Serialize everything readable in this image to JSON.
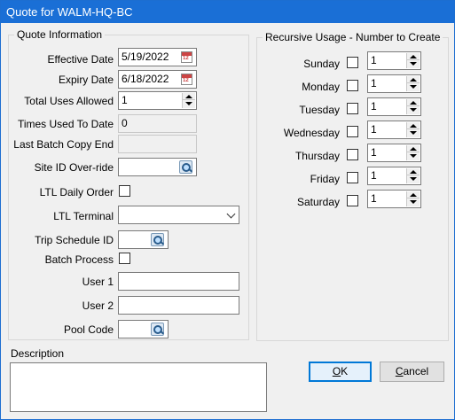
{
  "window": {
    "title": "Quote for WALM-HQ-BC"
  },
  "quote_info": {
    "group_title": "Quote Information",
    "effective_date": {
      "label": "Effective Date",
      "value": "5/19/2022"
    },
    "expiry_date": {
      "label": "Expiry Date",
      "value": "6/18/2022"
    },
    "total_uses_allowed": {
      "label": "Total Uses Allowed",
      "value": "1"
    },
    "times_used_to_date": {
      "label": "Times Used To Date",
      "value": "0"
    },
    "last_batch_copy_end": {
      "label": "Last Batch Copy End",
      "value": ""
    },
    "site_id_override": {
      "label": "Site ID Over-ride",
      "value": ""
    },
    "ltl_daily_order": {
      "label": "LTL Daily Order",
      "checked": false
    },
    "ltl_terminal": {
      "label": "LTL Terminal",
      "value": ""
    },
    "trip_schedule_id": {
      "label": "Trip Schedule ID",
      "value": ""
    },
    "batch_process": {
      "label": "Batch Process",
      "checked": false
    },
    "user1": {
      "label": "User 1",
      "value": ""
    },
    "user2": {
      "label": "User 2",
      "value": ""
    },
    "pool_code": {
      "label": "Pool Code",
      "value": ""
    }
  },
  "recursive_usage": {
    "group_title": "Recursive Usage - Number to Create",
    "days": [
      {
        "label": "Sunday",
        "checked": false,
        "value": "1"
      },
      {
        "label": "Monday",
        "checked": false,
        "value": "1"
      },
      {
        "label": "Tuesday",
        "checked": false,
        "value": "1"
      },
      {
        "label": "Wednesday",
        "checked": false,
        "value": "1"
      },
      {
        "label": "Thursday",
        "checked": false,
        "value": "1"
      },
      {
        "label": "Friday",
        "checked": false,
        "value": "1"
      },
      {
        "label": "Saturday",
        "checked": false,
        "value": "1"
      }
    ]
  },
  "description": {
    "label": "Description",
    "value": ""
  },
  "buttons": {
    "ok": {
      "mnemonic": "O",
      "rest": "K"
    },
    "cancel": {
      "mnemonic": "C",
      "rest": "ancel"
    }
  },
  "icons": {
    "calendar": "calendar-icon",
    "lookup": "lookup-magnifier-icon",
    "spinner": "spinner-updown-icon",
    "dropdown": "chevron-down-icon"
  },
  "colors": {
    "titlebar": "#1a6fd6",
    "default_button_border": "#0078d7",
    "window_bg": "#f0f0f0"
  }
}
